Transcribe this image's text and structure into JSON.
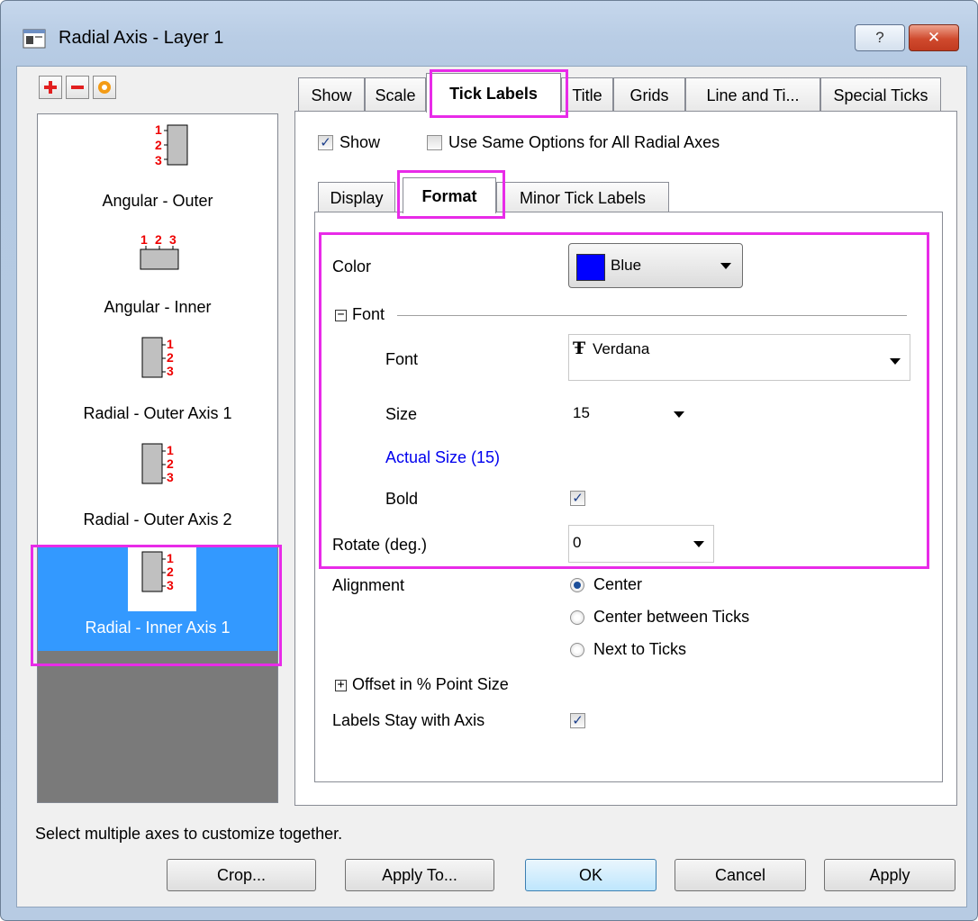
{
  "window": {
    "title": "Radial Axis - Layer 1",
    "help_label": "?",
    "close_label": "✕"
  },
  "toolbar": {
    "add_icon": "plus-icon",
    "remove_icon": "minus-icon",
    "reset_icon": "reset-icon"
  },
  "axes": [
    {
      "label": "Angular - Outer",
      "icon": "angular-outer-icon",
      "selected": false
    },
    {
      "label": "Angular - Inner",
      "icon": "angular-inner-icon",
      "selected": false
    },
    {
      "label": "Radial - Outer Axis 1",
      "icon": "radial-outer-icon",
      "selected": false
    },
    {
      "label": "Radial - Outer Axis 2",
      "icon": "radial-outer-icon",
      "selected": false
    },
    {
      "label": "Radial - Inner Axis 1",
      "icon": "radial-inner-icon",
      "selected": true
    }
  ],
  "tick_numbers": [
    "1",
    "2",
    "3"
  ],
  "tabs": [
    "Show",
    "Scale",
    "Tick Labels",
    "Title",
    "Grids",
    "Line and Ti...",
    "Special Ticks"
  ],
  "active_tab": "Tick Labels",
  "show_row": {
    "show_label": "Show",
    "show_checked": true,
    "same_label": "Use Same Options for All Radial Axes",
    "same_checked": false
  },
  "subtabs": [
    "Display",
    "Format",
    "Minor Tick Labels"
  ],
  "active_subtab": "Format",
  "format": {
    "color_label": "Color",
    "color_value": "Blue",
    "color_hex": "#0000ff",
    "font_group_label": "Font",
    "font_label": "Font",
    "font_value": "Verdana",
    "size_label": "Size",
    "size_value": "15",
    "actual_size": "Actual Size (15)",
    "bold_label": "Bold",
    "bold_checked": true,
    "rotate_label": "Rotate (deg.)",
    "rotate_value": "0",
    "alignment_label": "Alignment",
    "alignment_options": [
      "Center",
      "Center between Ticks",
      "Next to Ticks"
    ],
    "alignment_selected": "Center",
    "offset_label": "Offset in % Point Size",
    "labels_stay_label": "Labels Stay with Axis",
    "labels_stay_checked": true
  },
  "status_text": "Select multiple axes to customize together.",
  "buttons": {
    "crop": "Crop...",
    "apply_to": "Apply To...",
    "ok": "OK",
    "cancel": "Cancel",
    "apply": "Apply"
  },
  "highlight_color": "#e82be8"
}
